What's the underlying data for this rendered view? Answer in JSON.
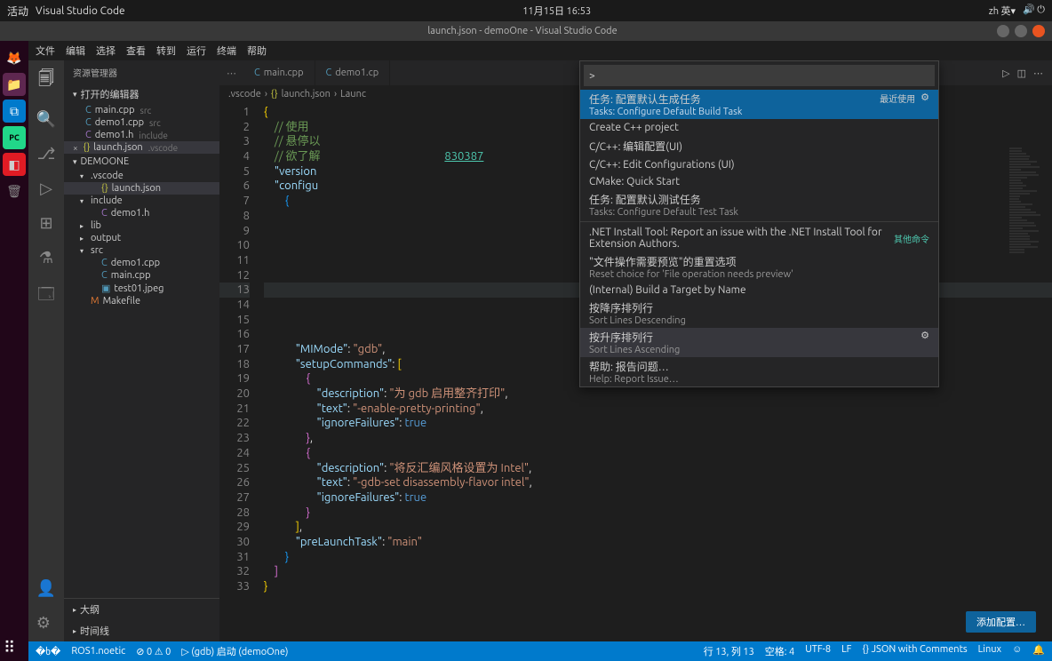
{
  "topbar": {
    "activities": "活动",
    "app": "Visual Studio Code",
    "datetime": "11月15日 16:53",
    "right": "zh 英▾"
  },
  "windowTitle": "launch.json - demoOne - Visual Studio Code",
  "menu": [
    "文件",
    "编辑",
    "选择",
    "查看",
    "转到",
    "运行",
    "终端",
    "帮助"
  ],
  "sidebar": {
    "title": "资源管理器",
    "openEditors": "打开的编辑器",
    "editors": [
      {
        "name": "main.cpp",
        "hint": "src",
        "icon": "cpp"
      },
      {
        "name": "demo1.cpp",
        "hint": "src",
        "icon": "cpp"
      },
      {
        "name": "demo1.h",
        "hint": "include",
        "icon": "h"
      },
      {
        "name": "launch.json",
        "hint": ".vscode",
        "icon": "json",
        "active": true
      }
    ],
    "project": "DEMOONE",
    "tree": [
      {
        "type": "folder",
        "name": ".vscode",
        "depth": 0
      },
      {
        "type": "file",
        "name": "launch.json",
        "icon": "json",
        "depth": 1,
        "selected": true
      },
      {
        "type": "folder",
        "name": "include",
        "depth": 0
      },
      {
        "type": "file",
        "name": "demo1.h",
        "icon": "h",
        "depth": 1
      },
      {
        "type": "folder",
        "name": "lib",
        "depth": 0,
        "collapsed": true
      },
      {
        "type": "folder",
        "name": "output",
        "depth": 0,
        "collapsed": true
      },
      {
        "type": "folder",
        "name": "src",
        "depth": 0
      },
      {
        "type": "file",
        "name": "demo1.cpp",
        "icon": "cpp",
        "depth": 1
      },
      {
        "type": "file",
        "name": "main.cpp",
        "icon": "cpp",
        "depth": 1
      },
      {
        "type": "file",
        "name": "test01.jpeg",
        "icon": "img",
        "depth": 1
      },
      {
        "type": "file",
        "name": "Makefile",
        "icon": "make",
        "depth": 0
      }
    ],
    "outline": "大纲",
    "timeline": "时间线"
  },
  "tabs": [
    {
      "name": "main.cpp",
      "icon": "cpp"
    },
    {
      "name": "demo1.cp",
      "icon": "cpp"
    }
  ],
  "breadcrumbs": [
    ".vscode",
    "launch.json",
    "Launc"
  ],
  "palette": {
    "prefix": ">",
    "recentlyUsed": "最近使用",
    "otherCmd": "其他命令",
    "items": [
      {
        "main": "任务: 配置默认生成任务",
        "sub": "Tasks: Configure Default Build Task",
        "selected": true,
        "gear": true,
        "badge": "最近使用"
      },
      {
        "main": "Create C++ project"
      },
      {
        "main": "C/C++: 编辑配置(UI)"
      },
      {
        "main": "C/C++: Edit Configurations (UI)"
      },
      {
        "main": "CMake: Quick Start"
      },
      {
        "main": "任务: 配置默认测试任务",
        "sub": "Tasks: Configure Default Test Task"
      },
      {
        "main": ".NET Install Tool: Report an issue with the .NET Install Tool for Extension Authors.",
        "badge": "其他命令",
        "sep": true
      },
      {
        "main": "\"文件操作需要预览\"的重置选项",
        "sub": "Reset choice for 'File operation needs preview'"
      },
      {
        "main": "(Internal) Build a Target by Name"
      },
      {
        "main": "按降序排列行",
        "sub": "Sort Lines Descending"
      },
      {
        "main": "按升序排列行",
        "sub": "Sort Lines Ascending",
        "highlight": true,
        "gear": true
      },
      {
        "main": "帮助: 报告问题…",
        "sub": "Help: Report Issue…"
      }
    ]
  },
  "code": {
    "lines": 33,
    "visibleLink": "830387",
    "line17a": "\"MIMode\"",
    "line17b": "\"gdb\"",
    "line18a": "\"setupCommands\"",
    "line20a": "\"description\"",
    "line20b": "\"为 gdb 启用整齐打印\"",
    "line21a": "\"text\"",
    "line21b": "\"-enable-pretty-printing\"",
    "line22a": "\"ignoreFailures\"",
    "line22b": "true",
    "line25b": "\"将反汇编风格设置为 Intel\"",
    "line26b": "\"-gdb-set disassembly-flavor intel\"",
    "line30a": "\"preLaunchTask\"",
    "line30b": "\"main\"",
    "commentUse": "// 使用 ",
    "commentHover": "// 悬停以",
    "commentWant": "// 欲了解",
    "versionKey": "\"version",
    "configKey": "\"configu"
  },
  "addConfigBtn": "添加配置…",
  "statusbar": {
    "ros": "ROS1.noetic",
    "errwarn": "⊘ 0 ⚠ 0",
    "debug": "(gdb) 启动 (demoOne)",
    "lncol": "行 13, 列 13",
    "spaces": "空格: 4",
    "encoding": "UTF-8",
    "eol": "LF",
    "lang": "JSON with Comments",
    "os": "Linux",
    "bell": "🔔"
  }
}
